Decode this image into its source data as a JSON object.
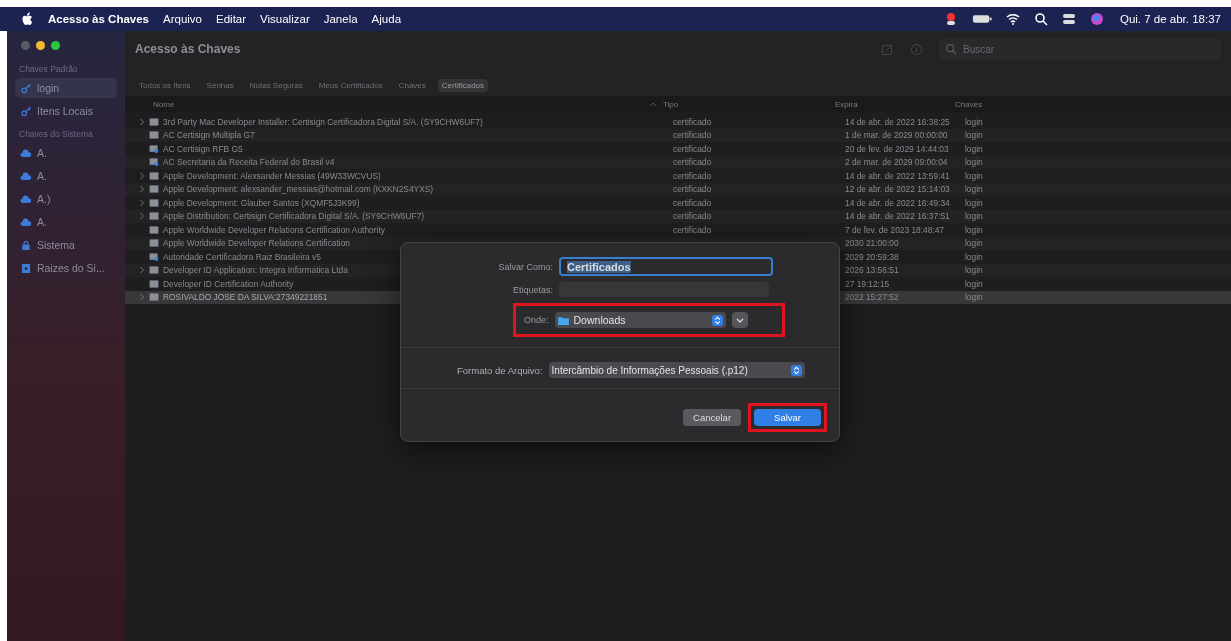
{
  "menu_bar": {
    "app": "Acesso às Chaves",
    "menus": [
      "Arquivo",
      "Editar",
      "Visualizar",
      "Janela",
      "Ajuda"
    ],
    "clock": "Qui. 7 de abr. 18:37"
  },
  "sidebar": {
    "sections": [
      {
        "title": "Chaves Padrão",
        "items": [
          {
            "label": "login",
            "kind": "keychain",
            "selected": true
          },
          {
            "label": "Itens Locais",
            "kind": "keychain",
            "selected": false
          }
        ]
      },
      {
        "title": "Chaves do Sistema",
        "items": [
          {
            "label": "A.",
            "kind": "cloud",
            "selected": false
          },
          {
            "label": "A.",
            "kind": "cloud",
            "selected": false
          },
          {
            "label": "A.)",
            "kind": "cloud",
            "selected": false
          },
          {
            "label": "A.",
            "kind": "cloud",
            "selected": false
          },
          {
            "label": "Sistema",
            "kind": "lock",
            "selected": false
          },
          {
            "label": "Raizes do Si...",
            "kind": "vault",
            "selected": false
          }
        ]
      }
    ]
  },
  "window": {
    "title": "Acesso às Chaves",
    "search": {
      "placeholder": "Buscar"
    }
  },
  "tabs": [
    {
      "label": "Todos os Itens",
      "selected": false
    },
    {
      "label": "Senhas",
      "selected": false
    },
    {
      "label": "Notas Seguras",
      "selected": false
    },
    {
      "label": "Meus Certificados",
      "selected": false
    },
    {
      "label": "Chaves",
      "selected": false
    },
    {
      "label": "Certificados",
      "selected": true
    }
  ],
  "table": {
    "columns": [
      "Nome",
      "Tipo",
      "Expira",
      "Chaves"
    ],
    "rows": [
      {
        "name": "3rd Party Mac Developer Installer: Certisign  Certificadora Digital S/A. (SY9CHW6UF7)",
        "type": "certificado",
        "expires": "14 de abr. de 2022 16:38:25",
        "keychain": "login",
        "kind": "cert",
        "expandable": true,
        "selected": false
      },
      {
        "name": "AC Certisign Multipla G7",
        "type": "certificado",
        "expires": "1 de mar. de 2029 00:00:00",
        "keychain": "login",
        "kind": "cert",
        "expandable": false,
        "selected": false
      },
      {
        "name": "AC Certisign RFB G5",
        "type": "certificado",
        "expires": "20 de fev. de 2029 14:44:03",
        "keychain": "login",
        "kind": "root",
        "expandable": false,
        "selected": false
      },
      {
        "name": "AC Secretaria da Receita Federal do Brasil v4",
        "type": "certificado",
        "expires": "2 de mar. de 2029 09:00:04",
        "keychain": "login",
        "kind": "root",
        "expandable": false,
        "selected": false
      },
      {
        "name": "Apple Development: Alexsander Messias (49W33WCVUS)",
        "type": "certificado",
        "expires": "14 de abr. de 2022 13:59:41",
        "keychain": "login",
        "kind": "cert",
        "expandable": true,
        "selected": false
      },
      {
        "name": "Apple Development: alexsander_messias@hotmail.com (KXKN2S4YXS)",
        "type": "certificado",
        "expires": "12 de abr. de 2022 15:14:03",
        "keychain": "login",
        "kind": "cert",
        "expandable": true,
        "selected": false
      },
      {
        "name": "Apple Development: Glauber Santos (XQMF5J3K99)",
        "type": "certificado",
        "expires": "14 de abr. de 2022 16:49:34",
        "keychain": "login",
        "kind": "cert",
        "expandable": true,
        "selected": false
      },
      {
        "name": "Apple Distribution: Certisign  Certificadora Digital S/A. (SY9CHW6UF7)",
        "type": "certificado",
        "expires": "14 de abr. de 2022 16:37:51",
        "keychain": "login",
        "kind": "cert",
        "expandable": true,
        "selected": false
      },
      {
        "name": "Apple Worldwide Developer Relations Certification Authority",
        "type": "certificado",
        "expires": "7 de fev. de 2023 18:48:47",
        "keychain": "login",
        "kind": "cert",
        "expandable": false,
        "selected": false
      },
      {
        "name": "Apple Worldwide Developer Relations Certification",
        "expires": "2030 21:00:00",
        "keychain": "login",
        "kind": "cert",
        "expandable": false,
        "selected": false
      },
      {
        "name": "Autoridade Certificadora Raiz Brasileira v5",
        "expires": "2029 20:59:38",
        "keychain": "login",
        "kind": "root",
        "expandable": false,
        "selected": false
      },
      {
        "name": "Developer ID Application: Integra Informatica Ltda",
        "expires": "2026 13:56:51",
        "keychain": "login",
        "kind": "cert",
        "expandable": true,
        "selected": false
      },
      {
        "name": "Developer ID Certification Authority",
        "expires": "27 19:12:15",
        "keychain": "login",
        "kind": "cert",
        "expandable": false,
        "selected": false
      },
      {
        "name": "ROSIVALDO JOSE DA SILVA:27349221851",
        "expires": "2022 15:27:52",
        "keychain": "login",
        "kind": "cert",
        "expandable": true,
        "selected": true
      }
    ]
  },
  "dialog": {
    "save_as": {
      "label": "Salvar Como:",
      "value": "Certificados"
    },
    "tags": {
      "label": "Etiquetas:"
    },
    "where": {
      "label": "Onde:",
      "value": "Downloads",
      "highlighted": true
    },
    "format": {
      "label": "Formato de Arquivo:",
      "value": "Intercâmbio de Informações Pessoais (.p12)"
    },
    "buttons": [
      {
        "label": "Cancelar",
        "kind": "cancel",
        "highlighted": false
      },
      {
        "label": "Salvar",
        "kind": "default",
        "highlighted": true
      }
    ]
  }
}
